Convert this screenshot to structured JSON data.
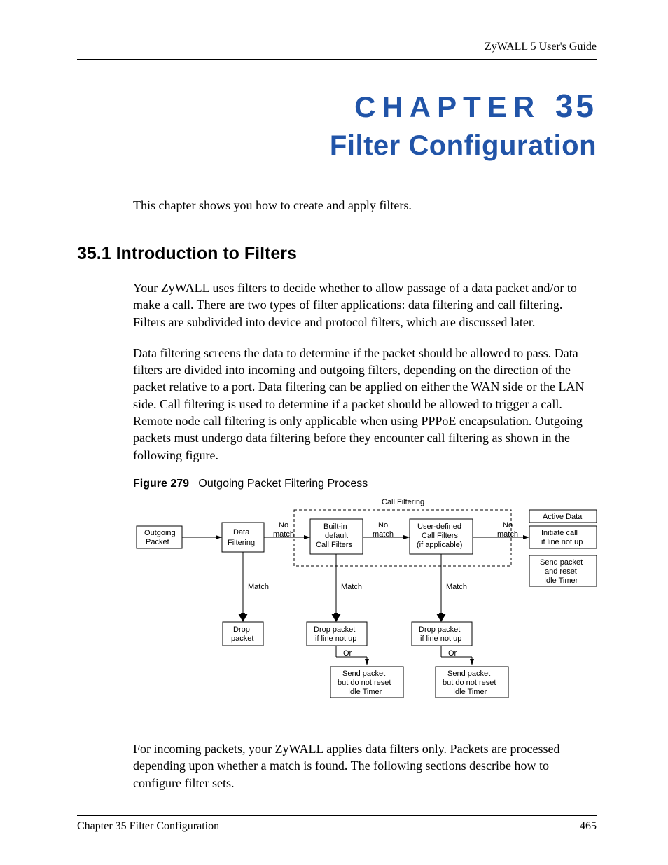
{
  "header": {
    "guide": "ZyWALL 5 User's Guide"
  },
  "chapter": {
    "label": "CHAPTER",
    "number": "35",
    "title": "Filter Configuration",
    "intro": "This chapter shows you how to create and apply filters."
  },
  "section": {
    "heading": "35.1  Introduction to Filters",
    "p1": "Your ZyWALL uses filters to decide whether to allow passage of a data packet and/or to make a call. There are two types of filter applications: data filtering and call filtering. Filters are subdivided into device and protocol filters, which are discussed later.",
    "p2": "Data filtering screens the data to determine if the packet should be allowed to pass. Data filters are divided into incoming and outgoing filters, depending on the direction of the packet relative to a port. Data filtering can be applied on either the WAN side or the LAN side. Call filtering is used to determine if a packet should be allowed to trigger a call. Remote node call filtering is only applicable when using PPPoE encapsulation. Outgoing packets must undergo data filtering before they encounter call filtering as shown in the following figure.",
    "p3": "For incoming packets, your ZyWALL applies data filters only. Packets are processed depending upon whether a match is found. The following sections describe how to configure filter sets."
  },
  "figure": {
    "label": "Figure 279",
    "caption": "Outgoing Packet Filtering Process",
    "group_label": "Call Filtering",
    "boxes": {
      "outgoing": [
        "Outgoing",
        "Packet"
      ],
      "data_filtering": [
        "Data",
        "Filtering"
      ],
      "builtin": [
        "Built-in",
        "default",
        "Call Filters"
      ],
      "user": [
        "User-defined",
        "Call Filters",
        "(if applicable)"
      ],
      "active": [
        "Active Data"
      ],
      "initiate": [
        "Initiate call",
        "if line not up"
      ],
      "sendreset": [
        "Send packet",
        "and reset",
        "Idle Timer"
      ],
      "drop1": [
        "Drop",
        "packet"
      ],
      "drop2": [
        "Drop packet",
        "if line not up"
      ],
      "drop3": [
        "Drop packet",
        "if line not up"
      ],
      "send2": [
        "Send packet",
        "but do not reset",
        "Idle Timer"
      ],
      "send3": [
        "Send packet",
        "but do not reset",
        "Idle Timer"
      ]
    },
    "labels": {
      "no_match": "No",
      "no_match2": "match",
      "match": "Match",
      "or": "Or"
    }
  },
  "footer": {
    "left": "Chapter 35 Filter Configuration",
    "right": "465"
  }
}
